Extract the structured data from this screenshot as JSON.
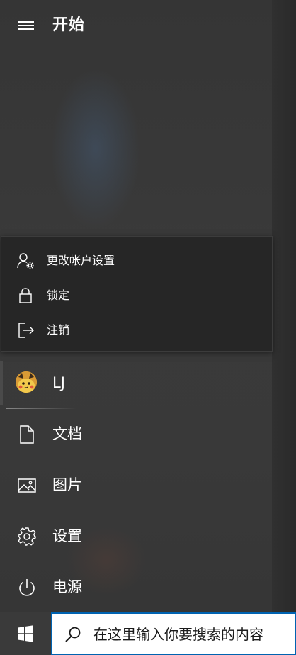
{
  "start_menu": {
    "title": "开始",
    "menu_icon": "hamburger-icon"
  },
  "account_flyout": {
    "items": [
      {
        "label": "更改帐户设置",
        "icon": "user-settings-icon"
      },
      {
        "label": "锁定",
        "icon": "lock-icon"
      },
      {
        "label": "注销",
        "icon": "sign-out-icon"
      }
    ]
  },
  "rail": {
    "user": {
      "name": "LJ",
      "icon": "avatar"
    },
    "items": [
      {
        "label": "文档",
        "icon": "document-icon"
      },
      {
        "label": "图片",
        "icon": "pictures-icon"
      },
      {
        "label": "设置",
        "icon": "gear-icon"
      },
      {
        "label": "电源",
        "icon": "power-icon"
      }
    ]
  },
  "taskbar": {
    "start_icon": "windows-logo-icon",
    "search_placeholder": "在这里输入你要搜索的内容",
    "search_icon": "search-icon",
    "accent_color": "#0063b1"
  }
}
